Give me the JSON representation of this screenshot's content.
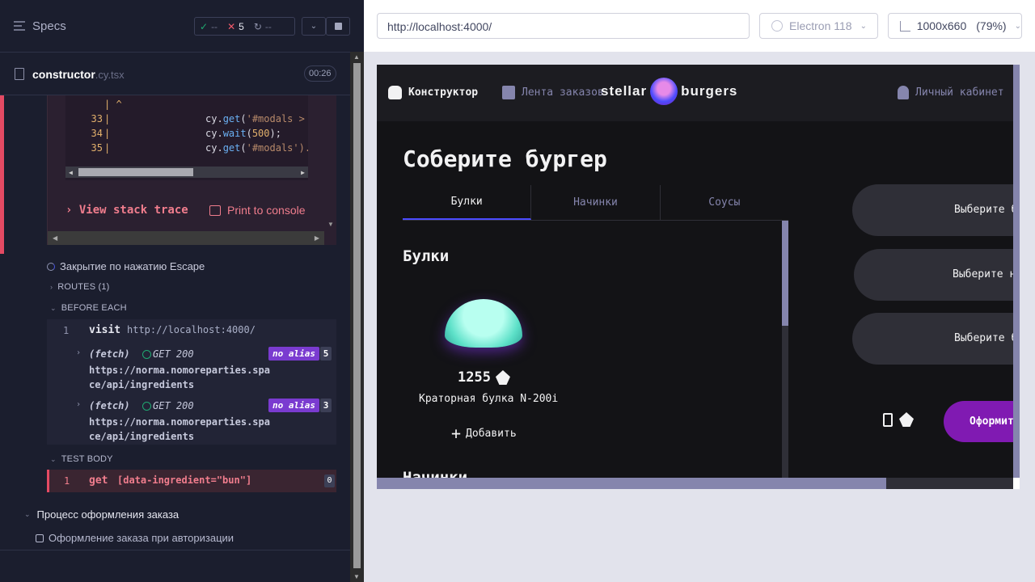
{
  "runner": {
    "specs_label": "Specs",
    "stats": {
      "passed": "--",
      "failed": "5",
      "pending": "--"
    },
    "file": {
      "name": "constructor",
      "ext": ".cy.tsx",
      "time": "00:26"
    },
    "code": {
      "caret": "|  ^",
      "lines": [
        {
          "num": "33",
          "text_fn": "get",
          "text_arg": "'#modals >"
        },
        {
          "num": "34",
          "text_fn": "wait",
          "text_arg": "500"
        },
        {
          "num": "35",
          "text_fn": "get",
          "text_arg": "'#modals')."
        }
      ]
    },
    "view_stack_trace": "View stack trace",
    "print_to_console": "Print to console",
    "test_escape": "Закрытие по нажатию Escape",
    "routes": "ROUTES (1)",
    "before_each": "BEFORE EACH",
    "visit": {
      "num": "1",
      "keyword": "visit",
      "url": "http://localhost:4000/"
    },
    "fetches": [
      {
        "label": "(fetch)",
        "status": "GET 200",
        "url": "https://norma.nomoreparties.space/api/ingredients",
        "alias": "no alias",
        "count": "5"
      },
      {
        "label": "(fetch)",
        "status": "GET 200",
        "url": "https://norma.nomoreparties.space/api/ingredients",
        "alias": "no alias",
        "count": "3"
      }
    ],
    "test_body": "TEST BODY",
    "get_cmd": {
      "num": "1",
      "keyword": "get",
      "selector": "[data-ingredient=\"bun\"]",
      "count": "0"
    },
    "suite_order": "Процесс оформления заказа",
    "test_auth": "Оформление заказа при авторизации"
  },
  "aut": {
    "url": "http://localhost:4000/",
    "browser": "Electron 118",
    "viewport": "1000x660",
    "zoom": "(79%)"
  },
  "app": {
    "nav": {
      "constructor": "Конструктор",
      "feed": "Лента заказов",
      "account": "Личный кабинет"
    },
    "logo": {
      "left": "stellar",
      "right": "burgers"
    },
    "title": "Соберите бургер",
    "tabs": [
      "Булки",
      "Начинки",
      "Соусы"
    ],
    "section_buns": "Булки",
    "bun": {
      "price": "1255",
      "name": "Краторная булка N-200i",
      "add": "Добавить"
    },
    "section_fillings": "Начинки",
    "slots": {
      "top": "Выберите б",
      "middle": "Выберите на",
      "bottom": "Выберите б"
    },
    "total": "0",
    "order_button": "Оформит"
  },
  "colors": {
    "accent": "#4c4cff",
    "order": "#801ab2",
    "error": "#e44a63",
    "pass": "#1fa971"
  }
}
